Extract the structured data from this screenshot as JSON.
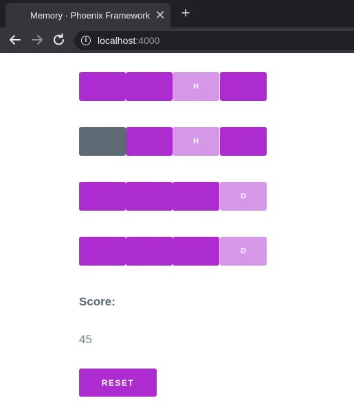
{
  "browser": {
    "tab_title": "Memory · Phoenix Framework",
    "close_glyph": "✕",
    "new_tab_glyph": "+",
    "url_host": "localhost",
    "url_port": ":4000",
    "info_glyph": "i"
  },
  "board": {
    "rows": [
      [
        {
          "state": "hidden",
          "letter": ""
        },
        {
          "state": "hidden",
          "letter": ""
        },
        {
          "state": "revealed",
          "letter": "H"
        },
        {
          "state": "hidden",
          "letter": ""
        }
      ],
      [
        {
          "state": "matched",
          "letter": ""
        },
        {
          "state": "hidden",
          "letter": ""
        },
        {
          "state": "revealed",
          "letter": "H"
        },
        {
          "state": "hidden",
          "letter": ""
        }
      ],
      [
        {
          "state": "hidden",
          "letter": ""
        },
        {
          "state": "hidden",
          "letter": ""
        },
        {
          "state": "hidden",
          "letter": ""
        },
        {
          "state": "revealed",
          "letter": "D"
        }
      ],
      [
        {
          "state": "hidden",
          "letter": ""
        },
        {
          "state": "hidden",
          "letter": ""
        },
        {
          "state": "hidden",
          "letter": ""
        },
        {
          "state": "revealed",
          "letter": "D"
        }
      ]
    ]
  },
  "score": {
    "label": "Score:",
    "value": "45"
  },
  "reset_label": "RESET",
  "colors": {
    "tile_hidden": "#ac2ccf",
    "tile_revealed": "#d598e8",
    "tile_matched": "#5e6b75"
  }
}
